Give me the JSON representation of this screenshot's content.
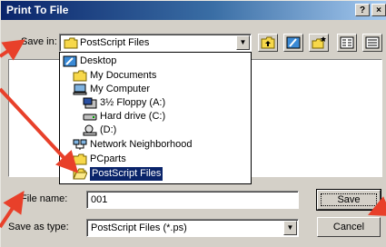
{
  "window": {
    "title": "Print To File",
    "help_label": "?",
    "close_label": "×"
  },
  "save_in": {
    "label": "Save in:",
    "value": "PostScript Files"
  },
  "toolbar": {
    "icons": [
      "up-one-level-icon",
      "desktop-icon",
      "new-folder-icon",
      "list-view-icon",
      "details-view-icon"
    ]
  },
  "location_dropdown": {
    "items": [
      {
        "label": "Desktop",
        "icon": "desktop-icon"
      },
      {
        "label": "My Documents",
        "icon": "folder-icon"
      },
      {
        "label": "My Computer",
        "icon": "computer-icon"
      },
      {
        "label": "3½ Floppy (A:)",
        "icon": "floppy-icon"
      },
      {
        "label": "Hard drive (C:)",
        "icon": "hard-drive-icon"
      },
      {
        "label": "(D:)",
        "icon": "cd-drive-icon"
      },
      {
        "label": "Network Neighborhood",
        "icon": "network-icon"
      },
      {
        "label": "PCparts",
        "icon": "folder-icon"
      },
      {
        "label": "PostScript Files",
        "icon": "open-folder-icon"
      }
    ],
    "selected": "PostScript Files"
  },
  "file_name": {
    "label": "File name:",
    "value": "001"
  },
  "save_as_type": {
    "label": "Save as type:",
    "value": "PostScript Files (*.ps)"
  },
  "buttons": {
    "save": "Save",
    "cancel": "Cancel"
  },
  "colors": {
    "title_bar": "#0a246a",
    "face": "#d4d0c8",
    "selection": "#0a246a",
    "annotation_arrow": "#e8402a"
  }
}
